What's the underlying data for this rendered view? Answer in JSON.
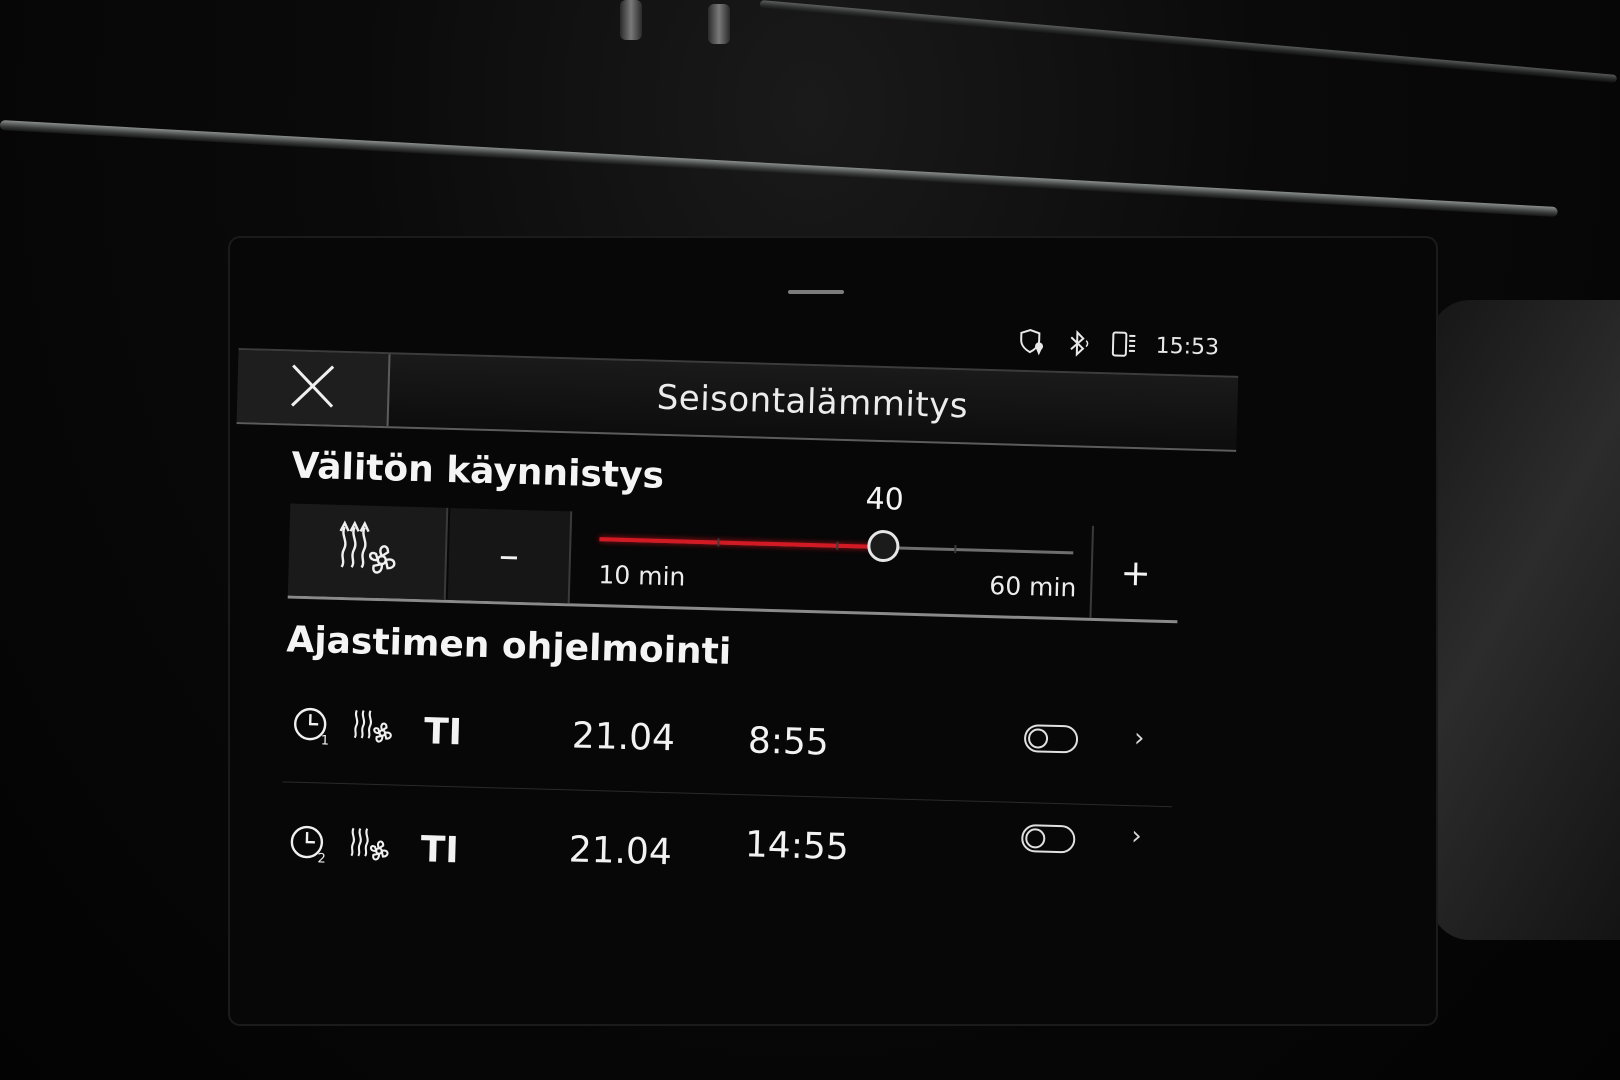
{
  "status": {
    "time": "15:53",
    "icons": [
      "security-location-icon",
      "bluetooth-icon",
      "phone-signal-icon"
    ]
  },
  "header": {
    "close_icon": "close-icon",
    "title": "Seisontalämmitys"
  },
  "instant_start": {
    "heading": "Välitön käynnistys",
    "mode_icon": "heat-fan-icon",
    "minus_label": "–",
    "plus_label": "+",
    "slider": {
      "value": "40",
      "min_label": "10 min",
      "max_label": "60 min",
      "min": 10,
      "max": 60,
      "current": 40
    },
    "accent_color": "#d11a24"
  },
  "timers": {
    "heading": "Ajastimen ohjelmointi",
    "items": [
      {
        "clock_icon": "timer-1-icon",
        "mode_icon": "heat-fan-icon",
        "day": "TI",
        "date": "21.04",
        "time": "8:55",
        "enabled": false
      },
      {
        "clock_icon": "timer-2-icon",
        "mode_icon": "heat-fan-icon",
        "day": "TI",
        "date": "21.04",
        "time": "14:55",
        "enabled": false
      }
    ]
  }
}
